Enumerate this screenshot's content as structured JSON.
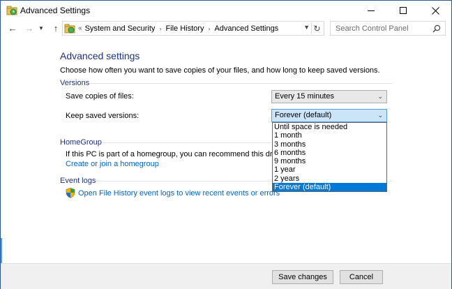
{
  "window": {
    "title": "Advanced Settings"
  },
  "address_bar": {
    "prefix": "«",
    "crumbs": [
      "System and Security",
      "File History",
      "Advanced Settings"
    ]
  },
  "search": {
    "placeholder": "Search Control Panel"
  },
  "main": {
    "heading": "Advanced settings",
    "description": "Choose how often you want to save copies of your files, and how long to keep saved versions.",
    "versions": {
      "title": "Versions",
      "save_copies_label": "Save copies of files:",
      "save_copies_value": "Every 15 minutes",
      "keep_versions_label": "Keep saved versions:",
      "keep_versions_value": "Forever (default)",
      "keep_versions_options": [
        "Until space is needed",
        "1 month",
        "3 months",
        "6 months",
        "9 months",
        "1 year",
        "2 years",
        "Forever (default)"
      ]
    },
    "homegroup": {
      "title": "HomeGroup",
      "text": "If this PC is part of a homegroup, you can recommend this drive to",
      "link": "Create or join a homegroup"
    },
    "event_logs": {
      "title": "Event logs",
      "link": "Open File History event logs to view recent events or errors"
    }
  },
  "footer": {
    "save_label": "Save changes",
    "cancel_label": "Cancel"
  },
  "colors": {
    "heading": "#1e3287",
    "link": "#0066cc",
    "selection": "#0078d7"
  }
}
